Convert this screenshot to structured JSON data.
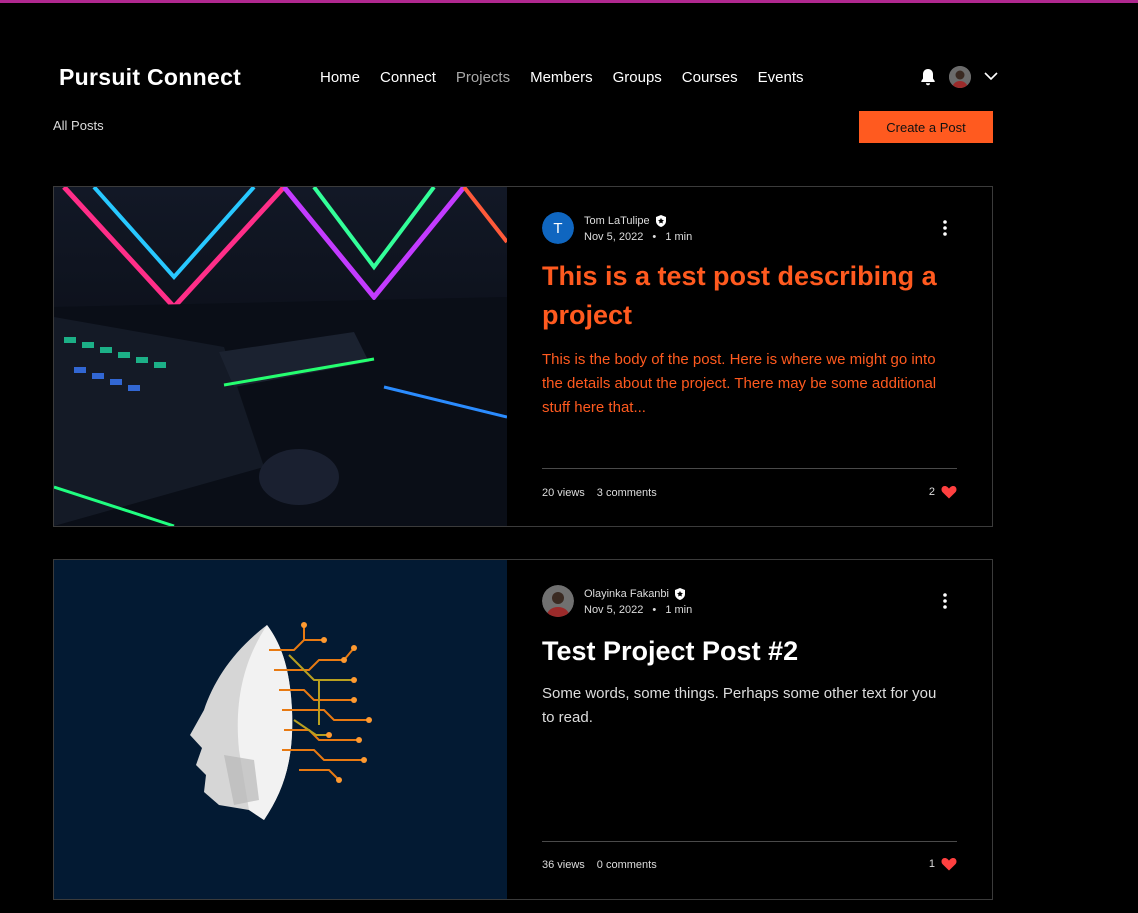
{
  "brand": "Pursuit Connect",
  "nav": [
    "Home",
    "Connect",
    "Projects",
    "Members",
    "Groups",
    "Courses",
    "Events"
  ],
  "active_nav": "Projects",
  "subheader": {
    "all_posts": "All Posts",
    "create_post": "Create a Post"
  },
  "colors": {
    "accent": "#ff5a1f",
    "like": "#ff4040",
    "topline": "#b0288f"
  },
  "posts": [
    {
      "author": "Tom LaTulipe",
      "avatar_letter": "T",
      "date": "Nov 5, 2022",
      "read_time": "1 min",
      "title": "This is a test post describing a project",
      "excerpt": "This is the body of the post. Here is where we might go into the details about the project. There may be some additional stuff here that...",
      "views": "20 views",
      "comments": "3 comments",
      "likes": "2"
    },
    {
      "author": "Olayinka Fakanbi",
      "date": "Nov 5, 2022",
      "read_time": "1 min",
      "title": "Test Project Post #2",
      "excerpt": "Some words, some things. Perhaps some other text for you to read.",
      "views": "36 views",
      "comments": "0 comments",
      "likes": "1"
    }
  ]
}
